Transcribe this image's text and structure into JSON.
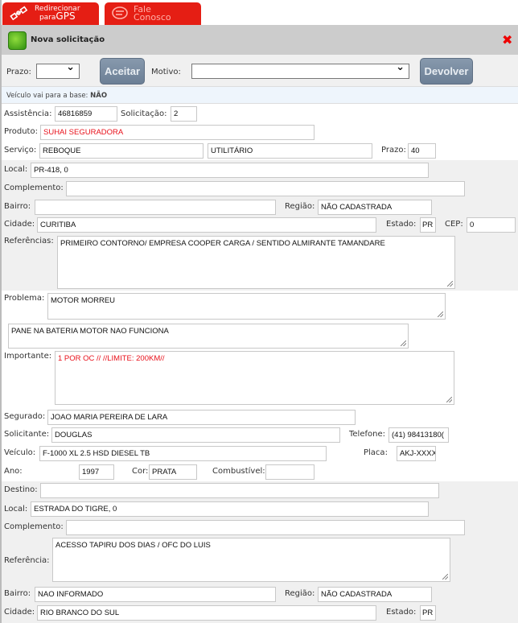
{
  "tabs": {
    "gps_line1": "Redirecionar",
    "gps_line2a": "para",
    "gps_line2b": "GPS",
    "contact_line1": "Fale",
    "contact_line2": "Conosco"
  },
  "dialog": {
    "title": "Nova solicitação"
  },
  "toolbar": {
    "prazo_label": "Prazo:",
    "prazo_value": "",
    "accept": "Aceitar",
    "motivo_label": "Motivo:",
    "motivo_value": "",
    "return": "Devolver"
  },
  "info": {
    "label": "Veículo vai para a base:",
    "value": "NÃO"
  },
  "form": {
    "assistencia_label": "Assistência:",
    "assistencia": "46816859",
    "solicitacao_label": "Solicitação:",
    "solicitacao": "2",
    "produto_label": "Produto:",
    "produto": "SUHAI SEGURADORA",
    "servico_label": "Serviço:",
    "servico": "REBOQUE",
    "servico_tipo": "UTILITÁRIO",
    "prazo_label": "Prazo:",
    "prazo": "40",
    "local_label": "Local:",
    "local": "PR-418, 0",
    "complemento_label": "Complemento:",
    "complemento": "",
    "bairro_label": "Bairro:",
    "bairro": "",
    "regiao_label": "Região:",
    "regiao": "NÃO CADASTRADA",
    "cidade_label": "Cidade:",
    "cidade": "CURITIBA",
    "estado_label": "Estado:",
    "estado": "PR",
    "cep_label": "CEP:",
    "cep": "0",
    "referencias_label": "Referências:",
    "referencias": "PRIMEIRO CONTORNO/ EMPRESA COOPER CARGA / SENTIDO ALMIRANTE TAMANDARE",
    "problema_label": "Problema:",
    "problema": "MOTOR MORREU",
    "problema_detalhe": "PANE NA BATERIA MOTOR NAO FUNCIONA",
    "importante_label": "Importante:",
    "importante": "1 POR OC //  //LIMITE: 200KM//",
    "segurado_label": "Segurado:",
    "segurado": "JOAO MARIA PEREIRA DE LARA",
    "solicitante_label": "Solicitante:",
    "solicitante": "DOUGLAS",
    "telefone_label": "Telefone:",
    "telefone": "(41) 98413180(",
    "veiculo_label": "Veículo:",
    "veiculo": "F-1000 XL 2.5 HSD DIESEL TB",
    "placa_label": "Placa:",
    "placa": "AKJ-XXXX",
    "ano_label": "Ano:",
    "ano": "1997",
    "cor_label": "Cor:",
    "cor": "PRATA",
    "combustivel_label": "Combustível:",
    "combustivel": ""
  },
  "destino": {
    "destino_label": "Destino:",
    "destino": "",
    "local_label": "Local:",
    "local": "ESTRADA DO TIGRE, 0",
    "complemento_label": "Complemento:",
    "complemento": "",
    "referencia_label": "Referência:",
    "referencia": "ACESSO TAPIRU DOS DIAS  / OFC DO LUIS",
    "bairro_label": "Bairro:",
    "bairro": "NAO INFORMADO",
    "regiao_label": "Região:",
    "regiao": "NÃO CADASTRADA",
    "cidade_label": "Cidade:",
    "cidade": "RIO BRANCO DO SUL",
    "estado_label": "Estado:",
    "estado": "PR"
  },
  "colors": {
    "tab_red": "#e51e14",
    "required_red": "#e8101a",
    "header_gray": "#cccccc",
    "button": "#7a8ca1"
  }
}
